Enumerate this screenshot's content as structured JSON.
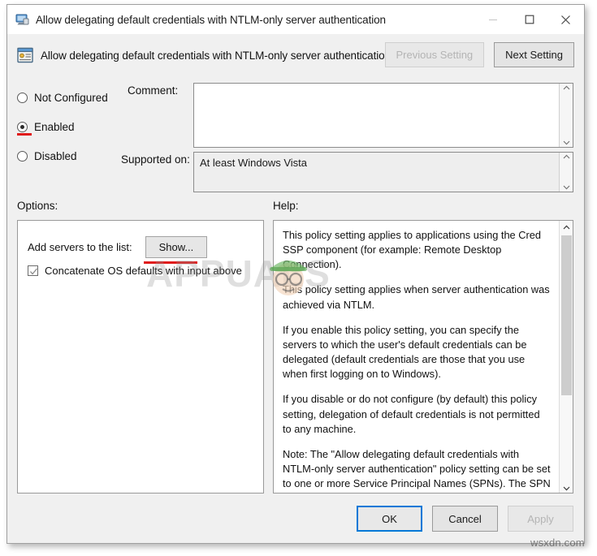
{
  "window": {
    "title": "Allow delegating default credentials with NTLM-only server authentication",
    "title_icon": "computer-monitor-icon",
    "controls": {
      "minimize": "minimize-icon",
      "maximize": "maximize-icon",
      "close": "close-icon"
    }
  },
  "header": {
    "icon": "policy-setting-icon",
    "title": "Allow delegating default credentials with NTLM-only server authentication",
    "previous_setting_label": "Previous Setting",
    "previous_setting_enabled": false,
    "next_setting_label": "Next Setting",
    "next_setting_enabled": true
  },
  "state": {
    "radios": [
      {
        "label": "Not Configured",
        "selected": false
      },
      {
        "label": "Enabled",
        "selected": true
      },
      {
        "label": "Disabled",
        "selected": false
      }
    ],
    "comment_label": "Comment:",
    "comment_value": "",
    "supported_on_label": "Supported on:",
    "supported_on_value": "At least Windows Vista"
  },
  "options": {
    "section_label": "Options:",
    "add_servers_label": "Add servers to the list:",
    "show_button_label": "Show...",
    "checkbox_label": "Concatenate OS defaults with input above",
    "checkbox_checked": true
  },
  "help": {
    "section_label": "Help:",
    "paragraphs": [
      "This policy setting applies to applications using the Cred SSP component (for example: Remote Desktop Connection).",
      "This policy setting applies when server authentication was achieved via NTLM.",
      "If you enable this policy setting, you can specify the servers to which the user's default credentials can be delegated (default credentials are those that you use when first logging on to Windows).",
      "If you disable or do not configure (by default) this policy setting, delegation of default credentials is not permitted to any machine.",
      "Note: The \"Allow delegating default credentials with NTLM-only server authentication\" policy setting can be set to one or more Service Principal Names (SPNs). The SPN represents the target server to which the user credentials can be delegated.  The use of a single wildcard character is permitted when specifying the SPN."
    ]
  },
  "footer": {
    "ok_label": "OK",
    "cancel_label": "Cancel",
    "apply_label": "Apply",
    "apply_enabled": false
  },
  "watermarks": {
    "center_text": "APPUALS",
    "corner_text": "wsxdn.com"
  },
  "colors": {
    "annotation_red": "#e01b1b",
    "focus_blue": "#0078d7",
    "dialog_bg": "#f0f0f0",
    "panel_bg": "#ffffff"
  }
}
